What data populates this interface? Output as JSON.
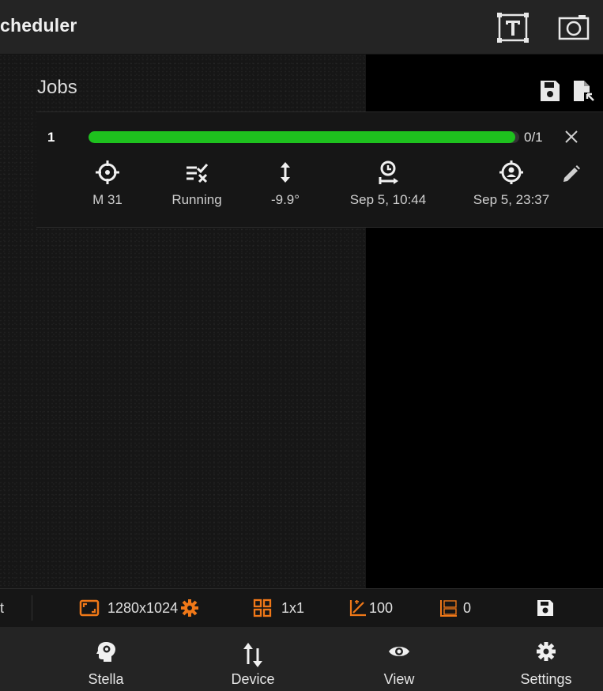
{
  "app": {
    "title": "cheduler"
  },
  "toolbar": {
    "text_mode_icon": "text-box-icon",
    "camera_view_icon": "camera-frame-icon"
  },
  "jobs": {
    "title": "Jobs",
    "save_icon": "save-icon",
    "load_icon": "load-file-icon",
    "items": [
      {
        "index": "1",
        "progress_text": "0/1",
        "progress_fraction": 0.99,
        "progress_color": "#1ec11e",
        "target": "M 31",
        "status": "Running",
        "altitude": "-9.9°",
        "start": "Sep 5, 10:44",
        "end": "Sep 5, 23:37"
      }
    ]
  },
  "statusbar": {
    "left_text": "t",
    "resolution": "1280x1024",
    "binning": "1x1",
    "gain": "100",
    "offset": "0",
    "accent_color": "#f07818"
  },
  "nav": {
    "items": [
      {
        "label": "Stella",
        "icon": "stella-head-icon"
      },
      {
        "label": "Device",
        "icon": "device-arrows-icon"
      },
      {
        "label": "View",
        "icon": "eye-icon"
      },
      {
        "label": "Settings",
        "icon": "gear-icon"
      }
    ]
  }
}
